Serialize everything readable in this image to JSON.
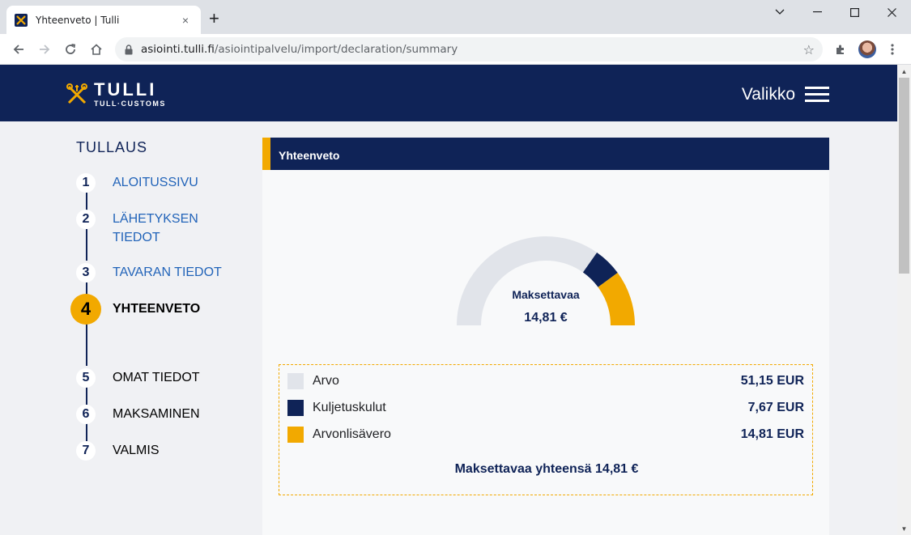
{
  "browser": {
    "tab_title": "Yhteenveto | Tulli",
    "tab_close": "×",
    "new_tab": "+",
    "url_host": "asiointi.tulli.fi",
    "url_path": "/asiointipalvelu/import/declaration/summary",
    "icons": [
      "back-icon",
      "forward-icon",
      "reload-icon",
      "home-icon",
      "lock-icon",
      "star-icon",
      "extensions-icon",
      "kebab-menu-icon"
    ]
  },
  "header": {
    "logo_main": "TULLI",
    "logo_sub": "TULL·CUSTOMS",
    "menu_label": "Valikko"
  },
  "steps": {
    "title": "TULLAUS",
    "items": [
      {
        "num": "1",
        "label": "ALOITUSSIVU"
      },
      {
        "num": "2",
        "label_line1": "LÄHETYKSEN",
        "label_line2": "TIEDOT"
      },
      {
        "num": "3",
        "label": "TAVARAN TIEDOT"
      },
      {
        "num": "4",
        "label": "YHTEENVETO"
      },
      {
        "num": "5",
        "label": "OMAT TIEDOT"
      },
      {
        "num": "6",
        "label": "MAKSAMINEN"
      },
      {
        "num": "7",
        "label": "VALMIS"
      }
    ]
  },
  "summary": {
    "title": "Yhteenveto",
    "gauge_label": "Maksettavaa",
    "gauge_value": "14,81 €",
    "rows": [
      {
        "label": "Arvo",
        "amount": "51,15 EUR",
        "value": 51.15,
        "color": "#e1e4ea"
      },
      {
        "label": "Kuljetuskulut",
        "amount": "7,67 EUR",
        "value": 7.67,
        "color": "#0f2357"
      },
      {
        "label": "Arvonlisävero",
        "amount": "14,81 EUR",
        "value": 14.81,
        "color": "#f2a900"
      }
    ],
    "total": "Maksettavaa yhteensä 14,81 €"
  },
  "colors": {
    "brand_navy": "#0f2357",
    "accent_yellow": "#f2a900",
    "link_blue": "#2264b9"
  }
}
